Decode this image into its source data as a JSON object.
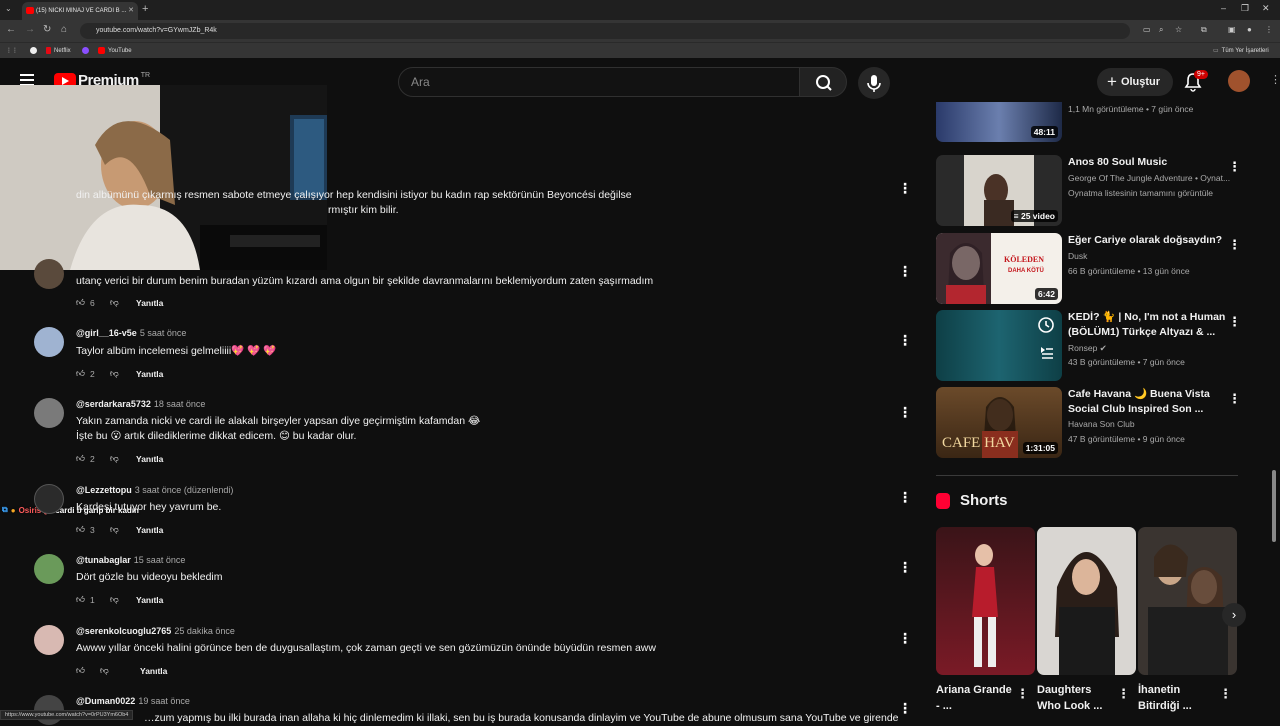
{
  "browser": {
    "tab_title": "(15) NICKI MINAJ VE CARDI B ...",
    "url": "youtube.com/watch?v=GYwmJZb_R4k",
    "bookmarks": [
      "Netflix",
      "YouTube"
    ],
    "all_bookmarks": "Tüm Yer İşaretleri",
    "status_url": "https://www.youtube.com/watch?v=0rPU3Ym6Ob4"
  },
  "header": {
    "logo_text": "Premium",
    "country_code": "TR",
    "search_placeholder": "Ara",
    "create_label": "Oluştur",
    "notification_count": "9+"
  },
  "comments": [
    {
      "text_line1": "din albümünü çıkarmış resmen sabote etmeye çalışıyor hep kendisini istiyor bu kadın rap sektörünün Beyoncési değilse",
      "text_line2": "rmıştır kim bilir."
    },
    {
      "text": "utanç verici bir durum benim buradan yüzüm kızardı ama olgun bir şekilde davranmalarını beklemiyordum zaten şaşırmadım",
      "likes": "6",
      "reply": "Yanıtla"
    },
    {
      "handle": "@girl__16-v5e",
      "time": "5 saat önce",
      "text": "Taylor albüm incelemesi gelmeliiii💖 💖 💖",
      "likes": "2",
      "reply": "Yanıtla"
    },
    {
      "handle": "@serdarkara5732",
      "time": "18 saat önce",
      "text_line1": "Yakın zamanda nicki ve cardi ile alakalı birşeyler yapsan diye geçirmiştim kafamdan 😂",
      "text_line2": "İşte bu 😮 artık dilediklerime dikkat edicem. 😊 bu kadar olur.",
      "likes": "2",
      "reply": "Yanıtla"
    },
    {
      "handle": "@Lezzettopu",
      "time": "3 saat önce (düzenlendi)",
      "text": "Kardeşi tutuyor hey yavrum be.",
      "likes": "3",
      "reply": "Yanıtla"
    },
    {
      "handle": "@tunabaglar",
      "time": "15 saat önce",
      "text": "Dört gözle bu videoyu bekledim",
      "likes": "1",
      "reply": "Yanıtla"
    },
    {
      "handle": "@serenkolcuoglu2765",
      "time": "25 dakika önce",
      "text": "Awww yıllar önceki halini görünce ben de duygusallaştım, çok zaman geçti ve sen gözümüzün önünde büyüdün resmen aww",
      "likes": "",
      "reply": "Yanıtla"
    },
    {
      "handle": "@Duman0022",
      "time": "19 saat önce",
      "text": "…zum yapmış bu ilki burada inan allaha ki hiç dinlemedim ki illaki, sen bu iş burada konusanda dinlayim ve YouTube de abune olmusum sana YouTube ve girende"
    }
  ],
  "chat_overlay": {
    "user": "OsirisQ",
    "message": ": cardi b garip bir kadın"
  },
  "sidebar": {
    "videos": [
      {
        "title": "",
        "meta1": "1,1 Mn görüntüleme • 7 gün önce",
        "duration": "48:11"
      },
      {
        "title": "Anos 80 Soul Music",
        "meta1": "George Of The Jungle Adventure • Oynat...",
        "meta2": "Oynatma listesinin tamamını görüntüle",
        "duration": "25 video"
      },
      {
        "title": "Eğer Cariye olarak doğsaydın?",
        "meta1": "Dusk",
        "meta2": "66 B görüntüleme • 13 gün önce",
        "duration": "6:42",
        "thumb_text1": "KÖLEDEN",
        "thumb_text2": "DAHA KÖTÜ"
      },
      {
        "title": "KEDİ? 🐈 | No, I'm not a Human (BÖLÜM1) Türkçe Altyazı & ...",
        "meta1": "Ronsep ✔",
        "meta2": "43 B görüntüleme • 7 gün önce",
        "duration": ""
      },
      {
        "title": "Cafe Havana 🌙 Buena Vista Social Club Inspired Son ...",
        "meta1": "Havana Son Club",
        "meta2": "47 B görüntüleme • 9 gün önce",
        "duration": "1:31:05",
        "thumb_text1": "CAFE HAV"
      }
    ],
    "shorts_title": "Shorts",
    "shorts": [
      {
        "title": "Ariana Grande - ..."
      },
      {
        "title": "Daughters Who Look ..."
      },
      {
        "title": "İhanetin Bitirdiği ..."
      }
    ]
  }
}
